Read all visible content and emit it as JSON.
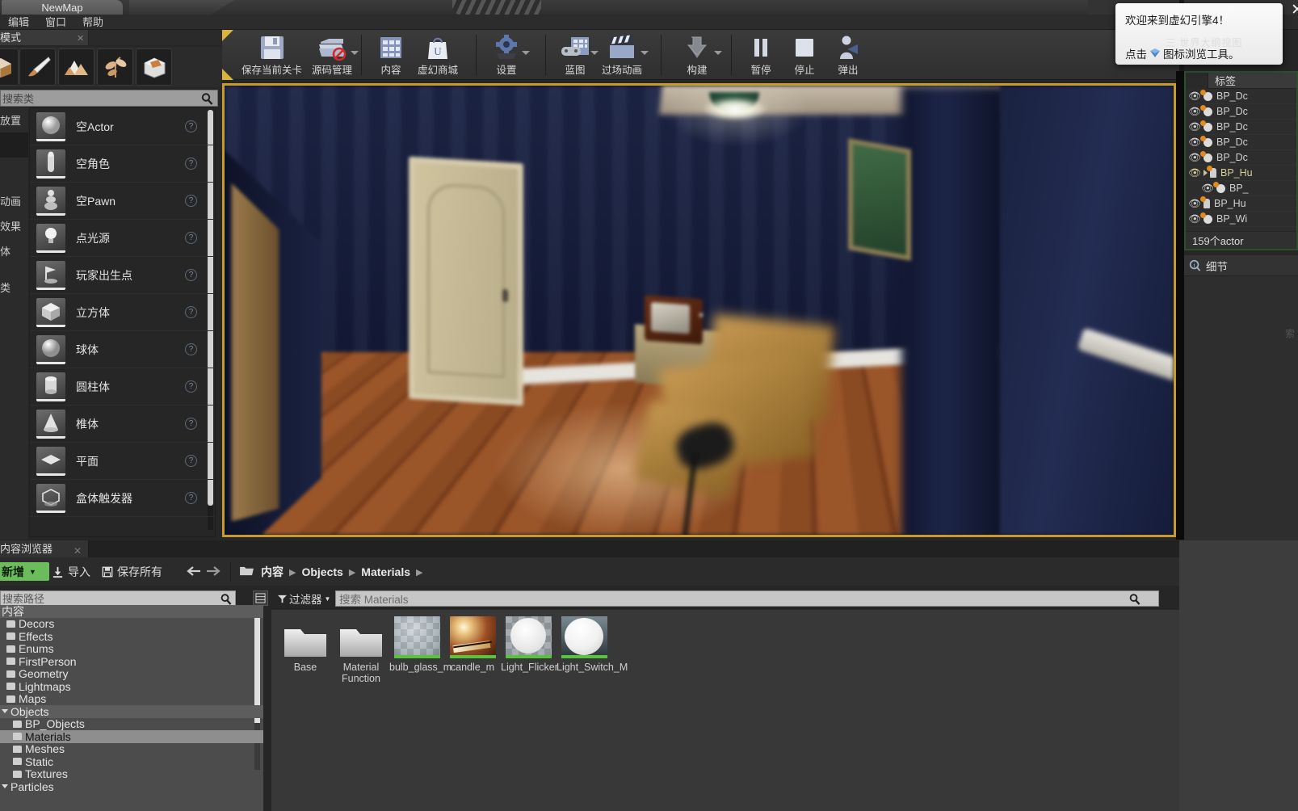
{
  "window": {
    "tab_title": "NewMap"
  },
  "menu": {
    "items": [
      "编辑",
      "窗口",
      "帮助"
    ]
  },
  "modes": {
    "tab_label": "模式",
    "buttons": [
      {
        "name": "place-mode",
        "icon": "cube-icon"
      },
      {
        "name": "paint-mode",
        "icon": "brush-icon"
      },
      {
        "name": "landscape-mode",
        "icon": "mountain-icon"
      },
      {
        "name": "foliage-mode",
        "icon": "leaf-icon"
      },
      {
        "name": "geometry-mode",
        "icon": "geometry-box-icon"
      }
    ],
    "search_placeholder": "搜索类",
    "categories": [
      "放置",
      "",
      "",
      "动画",
      "效果",
      "体",
      "",
      "类"
    ],
    "selected_category_index": 1,
    "actors": [
      {
        "label": "空Actor",
        "icon": "sphere-icon"
      },
      {
        "label": "空角色",
        "icon": "character-icon"
      },
      {
        "label": "空Pawn",
        "icon": "pawn-icon"
      },
      {
        "label": "点光源",
        "icon": "bulb-icon"
      },
      {
        "label": "玩家出生点",
        "icon": "playerstart-icon"
      },
      {
        "label": "立方体",
        "icon": "cube-icon"
      },
      {
        "label": "球体",
        "icon": "sphere-icon"
      },
      {
        "label": "圆柱体",
        "icon": "cylinder-icon"
      },
      {
        "label": "椎体",
        "icon": "cone-icon"
      },
      {
        "label": "平面",
        "icon": "plane-icon"
      },
      {
        "label": "盒体触发器",
        "icon": "boxtrigger-icon"
      }
    ]
  },
  "toolbar": {
    "groups": [
      {
        "items": [
          {
            "label": "保存当前关卡",
            "icon": "floppy-disk-icon",
            "dropdown": false
          },
          {
            "label": "源码管理",
            "icon": "source-control-icon",
            "dropdown": true
          }
        ]
      },
      {
        "items": [
          {
            "label": "内容",
            "icon": "content-grid-icon",
            "dropdown": false
          },
          {
            "label": "虚幻商城",
            "icon": "marketplace-bag-icon",
            "dropdown": false
          }
        ]
      },
      {
        "items": [
          {
            "label": "设置",
            "icon": "gear-icon",
            "dropdown": true
          }
        ]
      },
      {
        "items": [
          {
            "label": "蓝图",
            "icon": "blueprint-icon",
            "dropdown": true
          },
          {
            "label": "过场动画",
            "icon": "clapper-board-icon",
            "dropdown": true
          }
        ]
      },
      {
        "items": [
          {
            "label": "构建",
            "icon": "build-icon",
            "dropdown": true
          }
        ]
      },
      {
        "items": [
          {
            "label": "暂停",
            "icon": "pause-icon",
            "dropdown": false
          },
          {
            "label": "停止",
            "icon": "stop-icon",
            "dropdown": false
          },
          {
            "label": "弹出",
            "icon": "eject-icon",
            "dropdown": false
          }
        ]
      }
    ]
  },
  "viewport": {
    "state": "playing",
    "border_color": "#c69b2d"
  },
  "content_browser": {
    "tab_label": "内容浏览器",
    "add_button": "新增",
    "import_button": "导入",
    "save_all_button": "保存所有",
    "breadcrumb": [
      "内容",
      "Objects",
      "Materials"
    ],
    "source_search_placeholder": "搜索路径",
    "filter_button": "过滤器",
    "asset_search_placeholder": "搜索 Materials",
    "tree": [
      {
        "label": "内容",
        "depth": 0,
        "state": "root",
        "open": true
      },
      {
        "label": "Decors",
        "depth": 1,
        "state": "normal"
      },
      {
        "label": "Effects",
        "depth": 1,
        "state": "normal"
      },
      {
        "label": "Enums",
        "depth": 1,
        "state": "normal"
      },
      {
        "label": "FirstPerson",
        "depth": 1,
        "state": "normal"
      },
      {
        "label": "Geometry",
        "depth": 1,
        "state": "normal"
      },
      {
        "label": "Lightmaps",
        "depth": 1,
        "state": "normal"
      },
      {
        "label": "Maps",
        "depth": 1,
        "state": "normal"
      },
      {
        "label": "Objects",
        "depth": 1,
        "state": "highlight",
        "open": true
      },
      {
        "label": "BP_Objects",
        "depth": 2,
        "state": "normal"
      },
      {
        "label": "Materials",
        "depth": 2,
        "state": "selected"
      },
      {
        "label": "Meshes",
        "depth": 2,
        "state": "normal"
      },
      {
        "label": "Static",
        "depth": 2,
        "state": "normal"
      },
      {
        "label": "Textures",
        "depth": 2,
        "state": "normal"
      },
      {
        "label": "Particles",
        "depth": 1,
        "state": "normal",
        "open": true
      }
    ],
    "assets": [
      {
        "name": "Base",
        "type": "folder"
      },
      {
        "name": "Material Function",
        "type": "folder"
      },
      {
        "name": "bulb_glass_m",
        "type": "material",
        "style": "checker"
      },
      {
        "name": "candle_m",
        "type": "material",
        "style": "candle"
      },
      {
        "name": "Light_Flicker",
        "type": "material",
        "style": "white-sphere"
      },
      {
        "name": "Light_Switch_M",
        "type": "material",
        "style": "white-sphere-dark"
      }
    ]
  },
  "outliner": {
    "header_label": "标签",
    "rows": [
      {
        "label": "BP_Dc",
        "type": "actor",
        "indent": 0
      },
      {
        "label": "BP_Dc",
        "type": "actor",
        "indent": 0
      },
      {
        "label": "BP_Dc",
        "type": "actor",
        "indent": 0
      },
      {
        "label": "BP_Dc",
        "type": "actor",
        "indent": 0
      },
      {
        "label": "BP_Dc",
        "type": "actor",
        "indent": 0
      },
      {
        "label": "BP_Hu",
        "type": "person",
        "indent": 0,
        "selected": true,
        "expandable": true
      },
      {
        "label": "BP_",
        "type": "actor",
        "indent": 1
      },
      {
        "label": "BP_Hu",
        "type": "person",
        "indent": 0
      },
      {
        "label": "BP_Wi",
        "type": "actor",
        "indent": 0
      }
    ],
    "count_label": "159个actor"
  },
  "details": {
    "title": "细节"
  },
  "notification": {
    "line1": "欢迎来到虚幻引擎4！",
    "line2_prefix": "点击",
    "line2_suffix": "图标浏览工具。",
    "close_label": "✕"
  }
}
